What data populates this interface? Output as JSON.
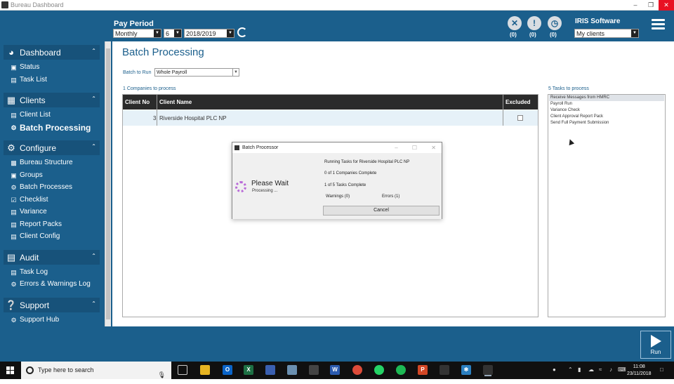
{
  "window": {
    "title": "Bureau Dashboard"
  },
  "header": {
    "pay_period_label": "Pay Period",
    "frequency": "Monthly",
    "period": "6",
    "year": "2018/2019",
    "counts": [
      "(0)",
      "(0)",
      "(0)"
    ],
    "company_name": "IRIS Software",
    "client_filter": "My clients"
  },
  "sidebar": {
    "sections": [
      {
        "label": "Dashboard",
        "items": [
          "Status",
          "Task List"
        ]
      },
      {
        "label": "Clients",
        "items": [
          "Client List",
          "Batch Processing"
        ]
      },
      {
        "label": "Configure",
        "items": [
          "Bureau Structure",
          "Groups",
          "Batch Processes",
          "Checklist",
          "Variance",
          "Report Packs",
          "Client Config"
        ]
      },
      {
        "label": "Audit",
        "items": [
          "Task Log",
          "Errors & Warnings Log"
        ]
      },
      {
        "label": "Support",
        "items": [
          "Support Hub"
        ]
      }
    ]
  },
  "main": {
    "title": "Batch Processing",
    "batch_to_run_label": "Batch to Run",
    "batch_to_run_value": "Whole Payroll",
    "companies_count_label": "1 Companies to process",
    "columns": [
      "Client No",
      "Client Name",
      "Excluded"
    ],
    "rows": [
      {
        "client_no": "3",
        "client_name": "Riverside Hospital PLC NP",
        "excluded": false
      }
    ],
    "tasks_label": "5 Tasks to process",
    "tasks": [
      "Receive Messages from HMRC",
      "Payroll Run",
      "Variance Check",
      "Client Approval Report Pack",
      "Send Full Payment Submission"
    ]
  },
  "dialog": {
    "title": "Batch Processor",
    "please_wait": "Please Wait",
    "processing": "Processing ...",
    "running": "Running Tasks for Riverside Hospital PLC NP",
    "companies_complete": "0 of 1 Companies Complete",
    "tasks_complete": "1 of 5 Tasks Complete",
    "warnings": "Warnings (0)",
    "errors": "Errors (1)",
    "cancel": "Cancel"
  },
  "footer": {
    "run_label": "Run"
  },
  "taskbar": {
    "search_placeholder": "Type here to search",
    "time": "11:08",
    "date": "23/11/2018"
  },
  "colors": {
    "brand": "#1b5f8c",
    "header_row": "#2b2b2b",
    "selected_row": "#e6f1f8"
  }
}
